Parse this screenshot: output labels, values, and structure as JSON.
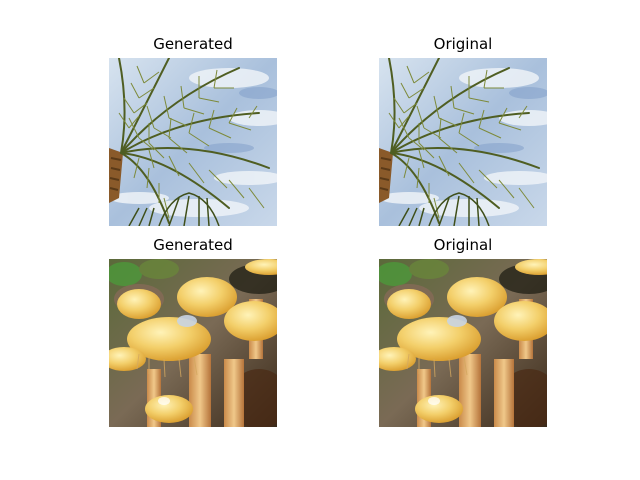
{
  "figure": {
    "panels": [
      {
        "title": "Generated",
        "content": "palm-tree-image"
      },
      {
        "title": "Original",
        "content": "palm-tree-image"
      },
      {
        "title": "Generated",
        "content": "mushroom-image"
      },
      {
        "title": "Original",
        "content": "mushroom-image"
      }
    ]
  }
}
